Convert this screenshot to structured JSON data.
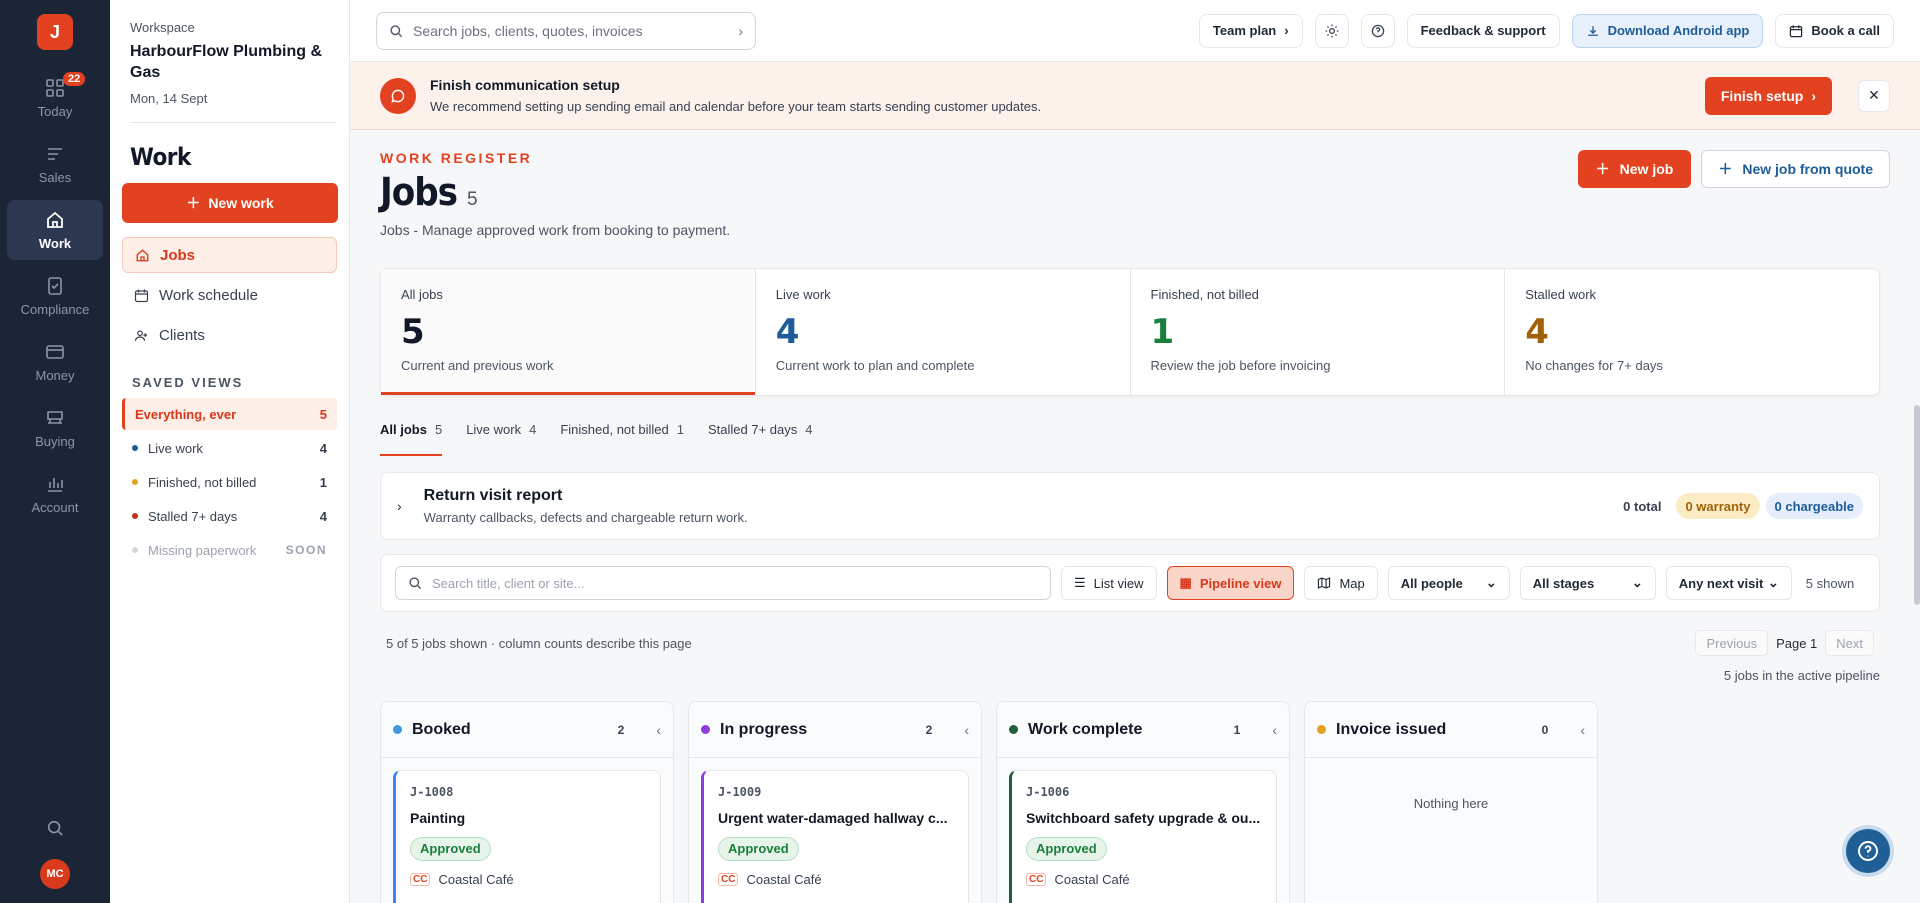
{
  "rail": {
    "logo": "J",
    "items": [
      {
        "label": "Today",
        "icon": "grid-icon",
        "badge": "22"
      },
      {
        "label": "Sales",
        "icon": "list-icon"
      },
      {
        "label": "Work",
        "icon": "home-icon",
        "active": true
      },
      {
        "label": "Compliance",
        "icon": "clipboard-check-icon"
      },
      {
        "label": "Money",
        "icon": "wallet-icon"
      },
      {
        "label": "Buying",
        "icon": "cart-icon"
      },
      {
        "label": "Account",
        "icon": "bar-chart-icon"
      }
    ],
    "user_initials": "MC"
  },
  "sidebar": {
    "workspace_label": "Workspace",
    "workspace_name": "HarbourFlow Plumbing & Gas",
    "date": "Mon, 14 Sept",
    "title": "Work",
    "new_work": "New work",
    "nav": [
      {
        "label": "Jobs",
        "icon": "home-icon",
        "active": true
      },
      {
        "label": "Work schedule",
        "icon": "calendar-icon"
      },
      {
        "label": "Clients",
        "icon": "user-plus-icon"
      }
    ],
    "saved_views_heading": "SAVED VIEWS",
    "saved_views": [
      {
        "label": "Everything, ever",
        "count": "5",
        "active": true
      },
      {
        "label": "Live work",
        "count": "4",
        "color": "#1d5b99"
      },
      {
        "label": "Finished, not billed",
        "count": "1",
        "color": "#e0a020"
      },
      {
        "label": "Stalled 7+ days",
        "count": "4",
        "color": "#c0301a"
      },
      {
        "label": "Missing paperwork",
        "soon": "SOON",
        "color": "#d1d5db"
      }
    ]
  },
  "topbar": {
    "search_placeholder": "Search jobs, clients, quotes, invoices",
    "team_plan": "Team plan",
    "feedback": "Feedback & support",
    "download": "Download Android app",
    "book_call": "Book a call"
  },
  "banner": {
    "title": "Finish communication setup",
    "subtitle": "We recommend setting up sending email and calendar before your team starts sending customer updates.",
    "action": "Finish setup"
  },
  "page": {
    "eyebrow": "WORK REGISTER",
    "title": "Jobs",
    "count": "5",
    "subtitle": "Jobs - Manage approved work from booking to payment.",
    "new_job": "New job",
    "new_job_quote": "New job from quote"
  },
  "stats": [
    {
      "label": "All jobs",
      "value": "5",
      "desc": "Current and previous work",
      "color": "#111827",
      "active": true
    },
    {
      "label": "Live work",
      "value": "4",
      "desc": "Current work to plan and complete",
      "color": "#1d5b99"
    },
    {
      "label": "Finished, not billed",
      "value": "1",
      "desc": "Review the job before invoicing",
      "color": "#1a7f3c"
    },
    {
      "label": "Stalled work",
      "value": "4",
      "desc": "No changes for 7+ days",
      "color": "#a16207"
    }
  ],
  "tabs": [
    {
      "label": "All jobs",
      "count": "5",
      "active": true
    },
    {
      "label": "Live work",
      "count": "4"
    },
    {
      "label": "Finished, not billed",
      "count": "1"
    },
    {
      "label": "Stalled 7+ days",
      "count": "4"
    }
  ],
  "report": {
    "title": "Return visit report",
    "subtitle": "Warranty callbacks, defects and chargeable return work.",
    "total": "0 total",
    "warranty": "0 warranty",
    "chargeable": "0 chargeable"
  },
  "filters": {
    "search_placeholder": "Search title, client or site...",
    "list_view": "List view",
    "pipeline_view": "Pipeline view",
    "map": "Map",
    "people": "All people",
    "stages": "All stages",
    "next_visit": "Any next visit",
    "shown": "5 shown"
  },
  "pager": {
    "summary": "5 of 5 jobs shown · column counts describe this page",
    "previous": "Previous",
    "page": "Page 1",
    "next": "Next",
    "active_info": "5 jobs in the active pipeline"
  },
  "columns": [
    {
      "title": "Booked",
      "count": "2",
      "color": "#3b9be0",
      "card": {
        "id": "J-1008",
        "title": "Painting",
        "status": "Approved",
        "client_initials": "CC",
        "client": "Coastal Café",
        "accent": "#3b82f6"
      }
    },
    {
      "title": "In progress",
      "count": "2",
      "color": "#8b3fd9",
      "card": {
        "id": "J-1009",
        "title": "Urgent water-damaged hallway c...",
        "status": "Approved",
        "client_initials": "CC",
        "client": "Coastal Café",
        "accent": "#8b3fd9"
      }
    },
    {
      "title": "Work complete",
      "count": "1",
      "color": "#1f5f3a",
      "card": {
        "id": "J-1006",
        "title": "Switchboard safety upgrade & ou...",
        "status": "Approved",
        "client_initials": "CC",
        "client": "Coastal Café",
        "accent": "#1f5f3a"
      }
    },
    {
      "title": "Invoice issued",
      "count": "0",
      "color": "#e0a020",
      "empty": "Nothing here"
    }
  ]
}
